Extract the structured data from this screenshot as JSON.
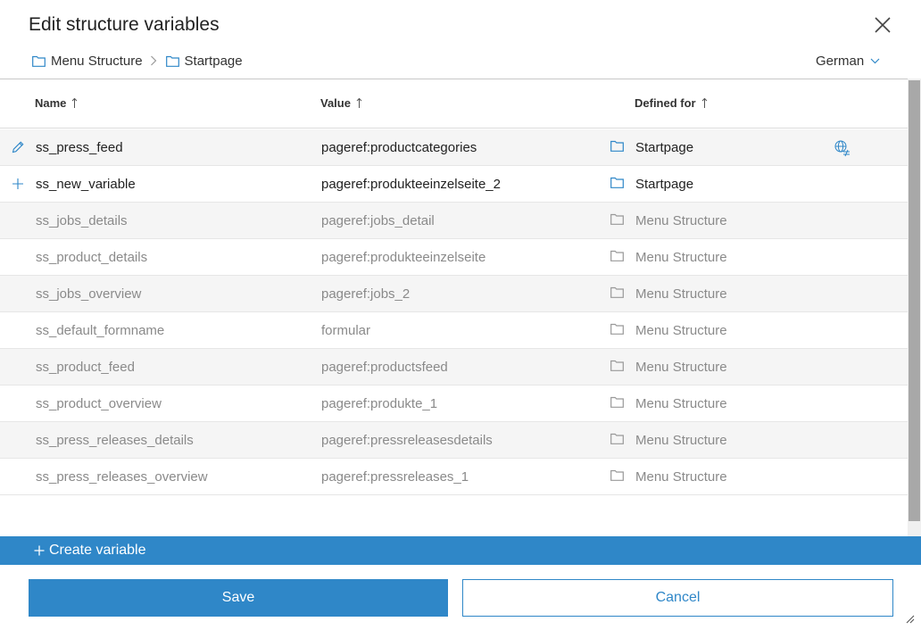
{
  "dialog": {
    "title": "Edit structure variables",
    "close_icon": "close-icon"
  },
  "breadcrumb": {
    "items": [
      {
        "label": "Menu Structure",
        "icon": "folder-icon"
      },
      {
        "label": "Startpage",
        "icon": "folder-icon"
      }
    ]
  },
  "language": {
    "selected": "German",
    "icon": "chevron-down-icon"
  },
  "table": {
    "columns": [
      {
        "label": "Name",
        "sort_icon": "sort-arrow-up-icon"
      },
      {
        "label": "Value",
        "sort_icon": "sort-arrow-up-icon"
      },
      {
        "label": "Defined for",
        "sort_icon": "sort-arrow-up-icon"
      }
    ],
    "rows": [
      {
        "name": "ss_press_feed",
        "value": "pageref:productcategories",
        "defined_for": "Startpage",
        "state": "edited",
        "row_icon": "pencil-icon",
        "action_icon": "language-unequal-icon"
      },
      {
        "name": "ss_new_variable",
        "value": "pageref:produkteeinzelseite_2",
        "defined_for": "Startpage",
        "state": "new",
        "row_icon": "plus-icon"
      },
      {
        "name": "ss_jobs_details",
        "value": "pageref:jobs_detail",
        "defined_for": "Menu Structure",
        "state": "inherited"
      },
      {
        "name": "ss_product_details",
        "value": "pageref:produkteeinzelseite",
        "defined_for": "Menu Structure",
        "state": "inherited"
      },
      {
        "name": "ss_jobs_overview",
        "value": "pageref:jobs_2",
        "defined_for": "Menu Structure",
        "state": "inherited"
      },
      {
        "name": "ss_default_formname",
        "value": "formular",
        "defined_for": "Menu Structure",
        "state": "inherited"
      },
      {
        "name": "ss_product_feed",
        "value": "pageref:productsfeed",
        "defined_for": "Menu Structure",
        "state": "inherited"
      },
      {
        "name": "ss_product_overview",
        "value": "pageref:produkte_1",
        "defined_for": "Menu Structure",
        "state": "inherited"
      },
      {
        "name": "ss_press_releases_details",
        "value": "pageref:pressreleasesdetails",
        "defined_for": "Menu Structure",
        "state": "inherited"
      },
      {
        "name": "ss_press_releases_overview",
        "value": "pageref:pressreleases_1",
        "defined_for": "Menu Structure",
        "state": "inherited"
      }
    ]
  },
  "actions": {
    "create_label": "Create variable",
    "save_label": "Save",
    "cancel_label": "Cancel"
  },
  "colors": {
    "accent": "#2f87c8",
    "row_alt": "#f5f5f5",
    "inherited_text": "#8a8a8a"
  }
}
